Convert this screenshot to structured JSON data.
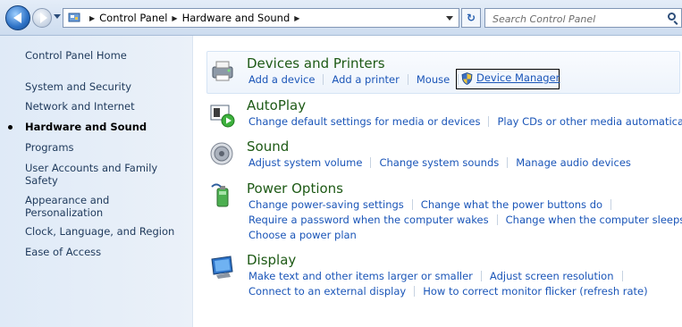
{
  "toolbar": {
    "breadcrumbs": [
      "Control Panel",
      "Hardware and Sound"
    ],
    "search_placeholder": "Search Control Panel"
  },
  "sidebar": {
    "items": [
      {
        "label": "Control Panel Home"
      },
      {
        "label": "System and Security"
      },
      {
        "label": "Network and Internet"
      },
      {
        "label": "Hardware and Sound",
        "active": true
      },
      {
        "label": "Programs"
      },
      {
        "label": "User Accounts and Family Safety"
      },
      {
        "label": "Appearance and Personalization"
      },
      {
        "label": "Clock, Language, and Region"
      },
      {
        "label": "Ease of Access"
      }
    ]
  },
  "categories": [
    {
      "title": "Devices and Printers",
      "icon": "printer-icon",
      "links": [
        "Add a device",
        "Add a printer",
        "Mouse",
        "Device Manager"
      ]
    },
    {
      "title": "AutoPlay",
      "icon": "autoplay-icon",
      "links": [
        "Change default settings for media or devices",
        "Play CDs or other media automatically"
      ]
    },
    {
      "title": "Sound",
      "icon": "speaker-icon",
      "links": [
        "Adjust system volume",
        "Change system sounds",
        "Manage audio devices"
      ]
    },
    {
      "title": "Power Options",
      "icon": "battery-icon",
      "links": [
        "Change power-saving settings",
        "Change what the power buttons do",
        "Require a password when the computer wakes",
        "Change when the computer sleeps",
        "Choose a power plan"
      ]
    },
    {
      "title": "Display",
      "icon": "monitor-icon",
      "links": [
        "Make text and other items larger or smaller",
        "Adjust screen resolution",
        "Connect to an external display",
        "How to correct monitor flicker (refresh rate)"
      ]
    }
  ],
  "colors": {
    "link": "#1a55b8",
    "category_title": "#1e5a16",
    "sidebar_bg": "#dfeaf7"
  }
}
